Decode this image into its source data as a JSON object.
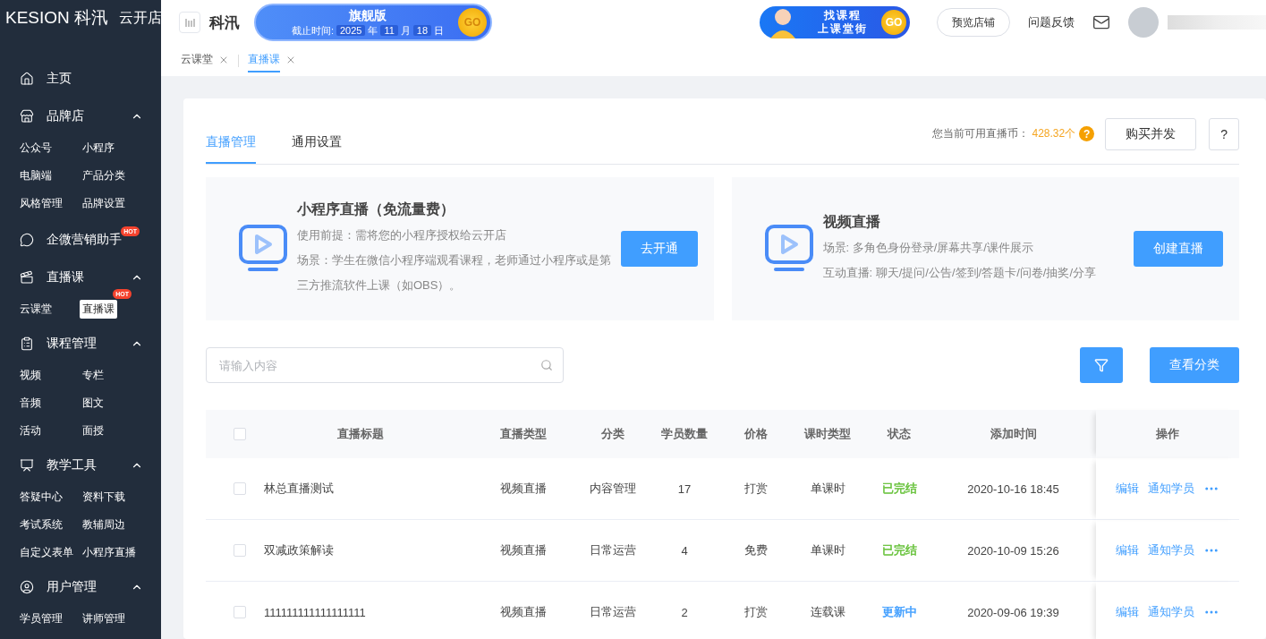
{
  "brand": {
    "logo": "KESION 科汛",
    "store": "云开店"
  },
  "sidebar": {
    "sections": [
      {
        "label": "主页"
      },
      {
        "label": "品牌店",
        "expanded": true,
        "children": [
          {
            "label": "公众号",
            "selected": false
          },
          {
            "label": "小程序",
            "selected": false
          },
          {
            "label": "电脑端",
            "selected": false
          },
          {
            "label": "产品分类",
            "selected": false
          },
          {
            "label": "风格管理",
            "selected": false
          },
          {
            "label": "品牌设置",
            "selected": false
          }
        ]
      },
      {
        "label": "企微营销助手",
        "badge": "HOT"
      },
      {
        "label": "直播课",
        "expanded": true,
        "children": [
          {
            "label": "云课堂",
            "selected": false
          },
          {
            "label": "直播课",
            "selected": true,
            "badge": "HOT"
          }
        ]
      },
      {
        "label": "课程管理",
        "expanded": true,
        "children": [
          {
            "label": "视频",
            "selected": false
          },
          {
            "label": "专栏",
            "selected": false
          },
          {
            "label": "音频",
            "selected": false
          },
          {
            "label": "图文",
            "selected": false
          },
          {
            "label": "活动",
            "selected": false
          },
          {
            "label": "面授",
            "selected": false
          }
        ]
      },
      {
        "label": "教学工具",
        "expanded": true,
        "children": [
          {
            "label": "答疑中心",
            "selected": false
          },
          {
            "label": "资料下载",
            "selected": false
          },
          {
            "label": "考试系统",
            "selected": false
          },
          {
            "label": "教辅周边",
            "selected": false
          },
          {
            "label": "自定义表单",
            "selected": false
          },
          {
            "label": "小程序直播",
            "selected": false
          }
        ]
      },
      {
        "label": "用户管理",
        "expanded": true,
        "children": [
          {
            "label": "学员管理",
            "selected": false
          },
          {
            "label": "讲师管理",
            "selected": false
          }
        ]
      }
    ]
  },
  "header": {
    "shop_name": "科汛",
    "edition_banner": {
      "title": "旗舰版",
      "deadline_label": "截止时间:",
      "year": "2025",
      "year_unit": "年",
      "month": "11",
      "month_unit": "月",
      "day": "18",
      "day_unit": "日",
      "go": "GO"
    },
    "promo_banner": {
      "line_1": "找课程",
      "line_2": "上课堂街",
      "go": "GO"
    },
    "preview_button": "预览店铺",
    "feedback_link": "问题反馈"
  },
  "page_tabs": [
    {
      "label": "云课堂",
      "selected": false
    },
    {
      "label": "直播课",
      "selected": true
    }
  ],
  "content_tabs": [
    {
      "label": "直播管理",
      "selected": true
    },
    {
      "label": "通用设置",
      "selected": false
    }
  ],
  "coins": {
    "label": "您当前可用直播币：",
    "value": "428.32个",
    "help_icon": "?"
  },
  "buy_button": "购买并发",
  "help_button": "?",
  "features": [
    {
      "title": "小程序直播（免流量费）",
      "lines": [
        "使用前提：需将您的小程序授权给云开店",
        "场景：学生在微信小程序端观看课程，老师通过小程序或是第三方推流软件上课（如OBS）。"
      ],
      "action": "去开通"
    },
    {
      "title": "视频直播",
      "lines": [
        "场景: 多角色身份登录/屏幕共享/课件展示",
        "互动直播: 聊天/提问/公告/签到/答题卡/问卷/抽奖/分享"
      ],
      "action": "创建直播"
    }
  ],
  "search": {
    "placeholder": "请输入内容"
  },
  "category_button": "查看分类",
  "table": {
    "columns": [
      "直播标题",
      "直播类型",
      "分类",
      "学员数量",
      "价格",
      "课时类型",
      "状态",
      "添加时间",
      "操作"
    ],
    "header_checked": false,
    "rows": [
      {
        "checked": false,
        "title": "林总直播测试",
        "type": "视频直播",
        "category": "内容管理",
        "students": "17",
        "price": "打赏",
        "lesson_type": "单课时",
        "status": "已完结",
        "color": "#67c23a",
        "time": "2020-10-16 18:45",
        "actions": [
          "编辑",
          "通知学员"
        ]
      },
      {
        "checked": false,
        "title": "双减政策解读",
        "type": "视频直播",
        "category": "日常运营",
        "students": "4",
        "price": "免费",
        "lesson_type": "单课时",
        "status": "已完结",
        "color": "#67c23a",
        "time": "2020-10-09 15:26",
        "actions": [
          "编辑",
          "通知学员"
        ]
      },
      {
        "checked": false,
        "title": "111111111111111111",
        "type": "视频直播",
        "category": "日常运营",
        "students": "2",
        "price": "打赏",
        "lesson_type": "连载课",
        "status": "更新中",
        "color": "#409eff",
        "time": "2020-09-06 19:39",
        "actions": [
          "编辑",
          "通知学员"
        ]
      }
    ]
  }
}
